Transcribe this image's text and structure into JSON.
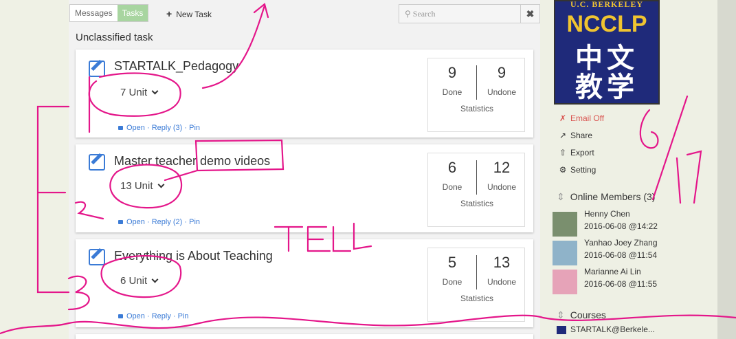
{
  "topbar": {
    "messages_tab": "Messages",
    "tasks_tab": "Tasks",
    "new_task_label": "New Task",
    "search_placeholder": "Search",
    "clear_label": "✖"
  },
  "section_title": "Unclassified task",
  "tasks": [
    {
      "title": "STARTALK_Pedagogy",
      "units": "7 Unit",
      "open": "Open",
      "reply": "Reply (3)",
      "pin": "Pin",
      "done": "9",
      "undone": "9",
      "done_label": "Done",
      "undone_label": "Undone",
      "stats_label": "Statistics"
    },
    {
      "title": "Master teacher demo videos",
      "units": "13 Unit",
      "open": "Open",
      "reply": "Reply (2)",
      "pin": "Pin",
      "done": "6",
      "undone": "12",
      "done_label": "Done",
      "undone_label": "Undone",
      "stats_label": "Statistics"
    },
    {
      "title": "Everything is About Teaching",
      "units": "6 Unit",
      "open": "Open",
      "reply": "Reply",
      "pin": "Pin",
      "done": "5",
      "undone": "13",
      "done_label": "Done",
      "undone_label": "Undone",
      "stats_label": "Statistics"
    }
  ],
  "logo": {
    "line1": "U.C. BERKELEY",
    "line2": "NCCLP",
    "line3": "中文",
    "line4": "教学"
  },
  "actions": {
    "email": "Email Off",
    "share": "Share",
    "export": "Export",
    "setting": "Setting"
  },
  "members": {
    "heading": "Online Members (3)",
    "list": [
      {
        "name": "Henny Chen",
        "time": "2016-06-08 @14:22"
      },
      {
        "name": "Yanhao Joey Zhang",
        "time": "2016-06-08 @11:54"
      },
      {
        "name": "Marianne Ai Lin",
        "time": "2016-06-08 @11:55"
      }
    ]
  },
  "courses": {
    "heading": "Courses",
    "item": "STARTALK@Berkele..."
  },
  "annotations": {
    "tell": "TELL",
    "date_top": "6",
    "date_bottom": "17",
    "num1": "1",
    "num2": "2",
    "num3": "3"
  },
  "colors": {
    "accent": "#3b7bd6",
    "tab_active": "#a8d5a0",
    "ink": "#e4168a",
    "email_off": "#d9534f"
  }
}
